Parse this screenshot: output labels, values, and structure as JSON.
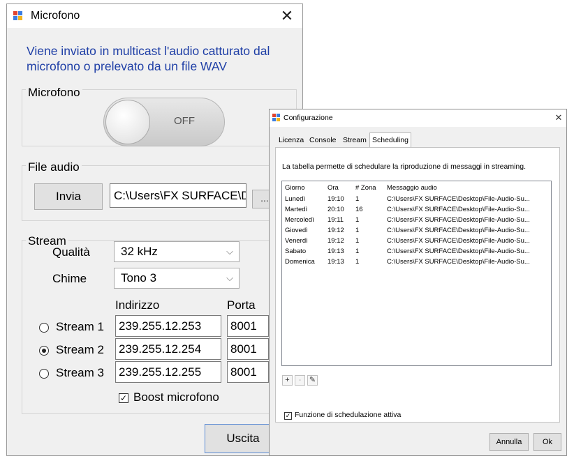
{
  "mic_window": {
    "title": "Microfono",
    "close_glyph": "✕",
    "description": "Viene inviato in multicast l'audio catturato dal microfono o prelevato da un file WAV",
    "microphone_group": {
      "label": "Microfono",
      "toggle_state": "OFF"
    },
    "file_group": {
      "label": "File audio",
      "send_button": "Invia",
      "file_path": "C:\\Users\\FX SURFACE\\Desktop",
      "browse_button": "..."
    },
    "stream_group": {
      "label": "Stream",
      "quality_label": "Qualità",
      "quality_value": "32 kHz",
      "chime_label": "Chime",
      "chime_value": "Tono 3",
      "address_header": "Indirizzo",
      "port_header": "Porta",
      "streams": [
        {
          "label": "Stream 1",
          "address": "239.255.12.253",
          "port": "8001",
          "selected": false
        },
        {
          "label": "Stream 2",
          "address": "239.255.12.254",
          "port": "8001",
          "selected": true
        },
        {
          "label": "Stream 3",
          "address": "239.255.12.255",
          "port": "8001",
          "selected": false
        }
      ],
      "boost_label": "Boost microfono",
      "boost_checked": true
    },
    "exit_button": "Uscita",
    "combo_arrow": "⌵",
    "check_glyph": "✓"
  },
  "config_window": {
    "title": "Configurazione",
    "close_glyph": "✕",
    "tabs": [
      "Licenza",
      "Console",
      "Stream",
      "Scheduling"
    ],
    "active_tab": "Scheduling",
    "description": "La tabella permette di schedulare la riproduzione di messaggi in streaming.",
    "columns": [
      "Giorno",
      "Ora",
      "# Zona",
      "Messaggio audio"
    ],
    "rows": [
      [
        "Lunedì",
        "19:10",
        "1",
        "C:\\Users\\FX SURFACE\\Desktop\\File-Audio-Su..."
      ],
      [
        "Martedì",
        "20:10",
        "16",
        "C:\\Users\\FX SURFACE\\Desktop\\File-Audio-Su..."
      ],
      [
        "Mercoledì",
        "19:11",
        "1",
        "C:\\Users\\FX SURFACE\\Desktop\\File-Audio-Su..."
      ],
      [
        "Giovedì",
        "19:12",
        "1",
        "C:\\Users\\FX SURFACE\\Desktop\\File-Audio-Su..."
      ],
      [
        "Venerdì",
        "19:12",
        "1",
        "C:\\Users\\FX SURFACE\\Desktop\\File-Audio-Su..."
      ],
      [
        "Sabato",
        "19:13",
        "1",
        "C:\\Users\\FX SURFACE\\Desktop\\File-Audio-Su..."
      ],
      [
        "Domenica",
        "19:13",
        "1",
        "C:\\Users\\FX SURFACE\\Desktop\\File-Audio-Su..."
      ]
    ],
    "toolbar": {
      "add": "+",
      "remove": "-",
      "edit": "✎"
    },
    "schedule_active_label": "Funzione di schedulazione attiva",
    "schedule_active_checked": true,
    "cancel_button": "Annulla",
    "ok_button": "Ok"
  },
  "colors": {
    "description_text": "#1f3fa6",
    "window_bg": "#f0f0f0",
    "focus_border": "#5b8bd4"
  }
}
